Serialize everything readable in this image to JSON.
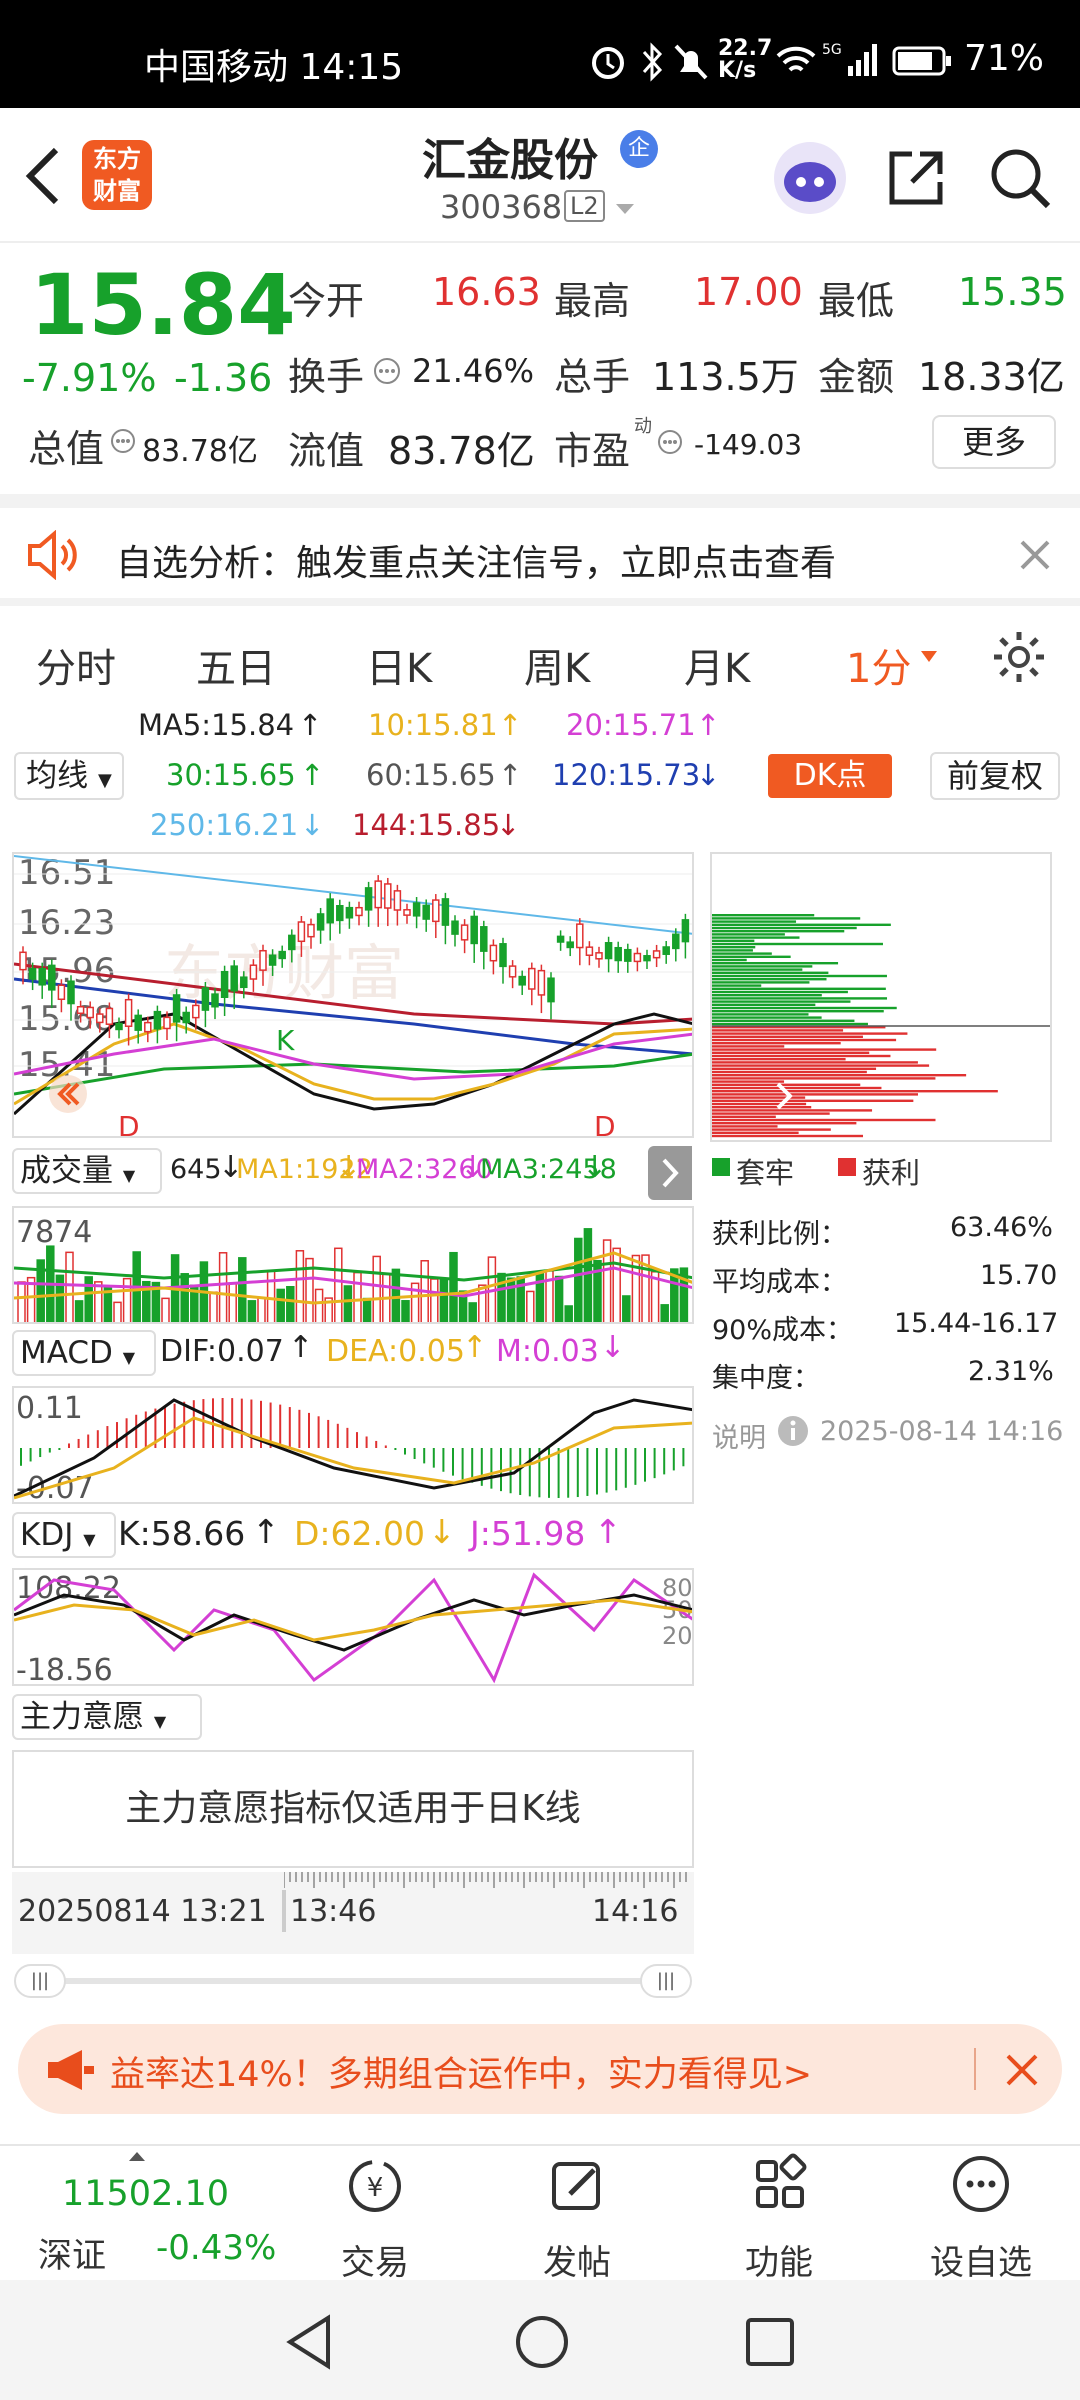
{
  "status": {
    "carrier_time": "中国移动 14:15",
    "speed_top": "22.7",
    "speed_bottom": "K/s",
    "battery": "71%"
  },
  "header": {
    "logo_line1": "东方",
    "logo_line2": "财富",
    "name": "汇金股份",
    "tag": "企",
    "code": "300368",
    "level": "L2"
  },
  "quote": {
    "price": "15.84",
    "chg_pct": "-7.91%",
    "chg": "-1.36",
    "open_label": "今开",
    "open": "16.63",
    "high_label": "最高",
    "high": "17.00",
    "low_label": "最低",
    "low": "15.35",
    "turnover_label": "换手",
    "turnover": "21.46%",
    "vol_label": "总手",
    "vol": "113.5万",
    "amt_label": "金额",
    "amt": "18.33亿",
    "mcap_label": "总值",
    "mcap": "83.78亿",
    "float_label": "流值",
    "float": "83.78亿",
    "pe_label": "市盈",
    "pe_sup": "动",
    "pe": "-149.03",
    "more": "更多"
  },
  "alert": {
    "text": "自选分析：触发重点关注信号，立即点击查看"
  },
  "tabs": [
    "分时",
    "五日",
    "日K",
    "周K",
    "月K",
    "1分"
  ],
  "ma": {
    "ma5": "MA5:15.84",
    "ma10": "10:15.81",
    "ma20": "20:15.71",
    "ma30": "30:15.65",
    "ma60": "60:15.65",
    "ma120": "120:15.73",
    "ma250": "250:16.21",
    "ma144": "144:15.85",
    "selector": "均线",
    "dk": "DK点",
    "fq": "前复权"
  },
  "colors": {
    "green": "#17a12b",
    "red": "#e03131",
    "orange": "#f05a22",
    "ma10": "#e8b21e",
    "ma20": "#d43fd4",
    "ma120": "#1f3fb0",
    "ma250": "#5fb8e8"
  },
  "main_chart": {
    "y_labels": [
      "16.51",
      "16.23",
      "15.96",
      "15.68",
      "15.41"
    ],
    "watermark": "东方财富",
    "marks": [
      "D",
      "K",
      "D"
    ]
  },
  "chip": {
    "legend_loss": "套牢",
    "legend_profit": "获利",
    "rows": [
      {
        "k": "获利比例：",
        "v": "63.46%"
      },
      {
        "k": "平均成本：",
        "v": "15.70"
      },
      {
        "k": "90%成本：",
        "v": "15.44-16.17"
      },
      {
        "k": "集中度：",
        "v": "2.31%"
      }
    ],
    "note": "说明",
    "date": "2025-08-14 14:16"
  },
  "volume": {
    "label": "成交量",
    "v": "645",
    "ma1": "MA1:1922",
    "ma2": "MA2:3260",
    "ma3": "MA3:2458",
    "ymax": "7874"
  },
  "macd": {
    "label": "MACD",
    "dif": "DIF:0.07",
    "dea": "DEA:0.05",
    "m": "M:0.03",
    "top": "0.11",
    "bottom": "-0.07"
  },
  "kdj": {
    "label": "KDJ",
    "k": "K:58.66",
    "d": "D:62.00",
    "j": "J:51.98",
    "top": "108.22",
    "bottom": "-18.56",
    "r80": "80",
    "r50": "50",
    "r20": "20"
  },
  "zlyy": {
    "label": "主力意愿",
    "msg": "主力意愿指标仅适用于日K线"
  },
  "timeaxis": {
    "start": "20250814 13:21",
    "mid": "13:46",
    "end": "14:16"
  },
  "banner": {
    "text": "益率达14%！多期组合运作中，实力看得见>"
  },
  "bottom": {
    "index_value": "11502.10",
    "index_name": "深证",
    "index_chg": "-0.43%",
    "items": [
      "交易",
      "发帖",
      "功能",
      "设自选"
    ]
  }
}
